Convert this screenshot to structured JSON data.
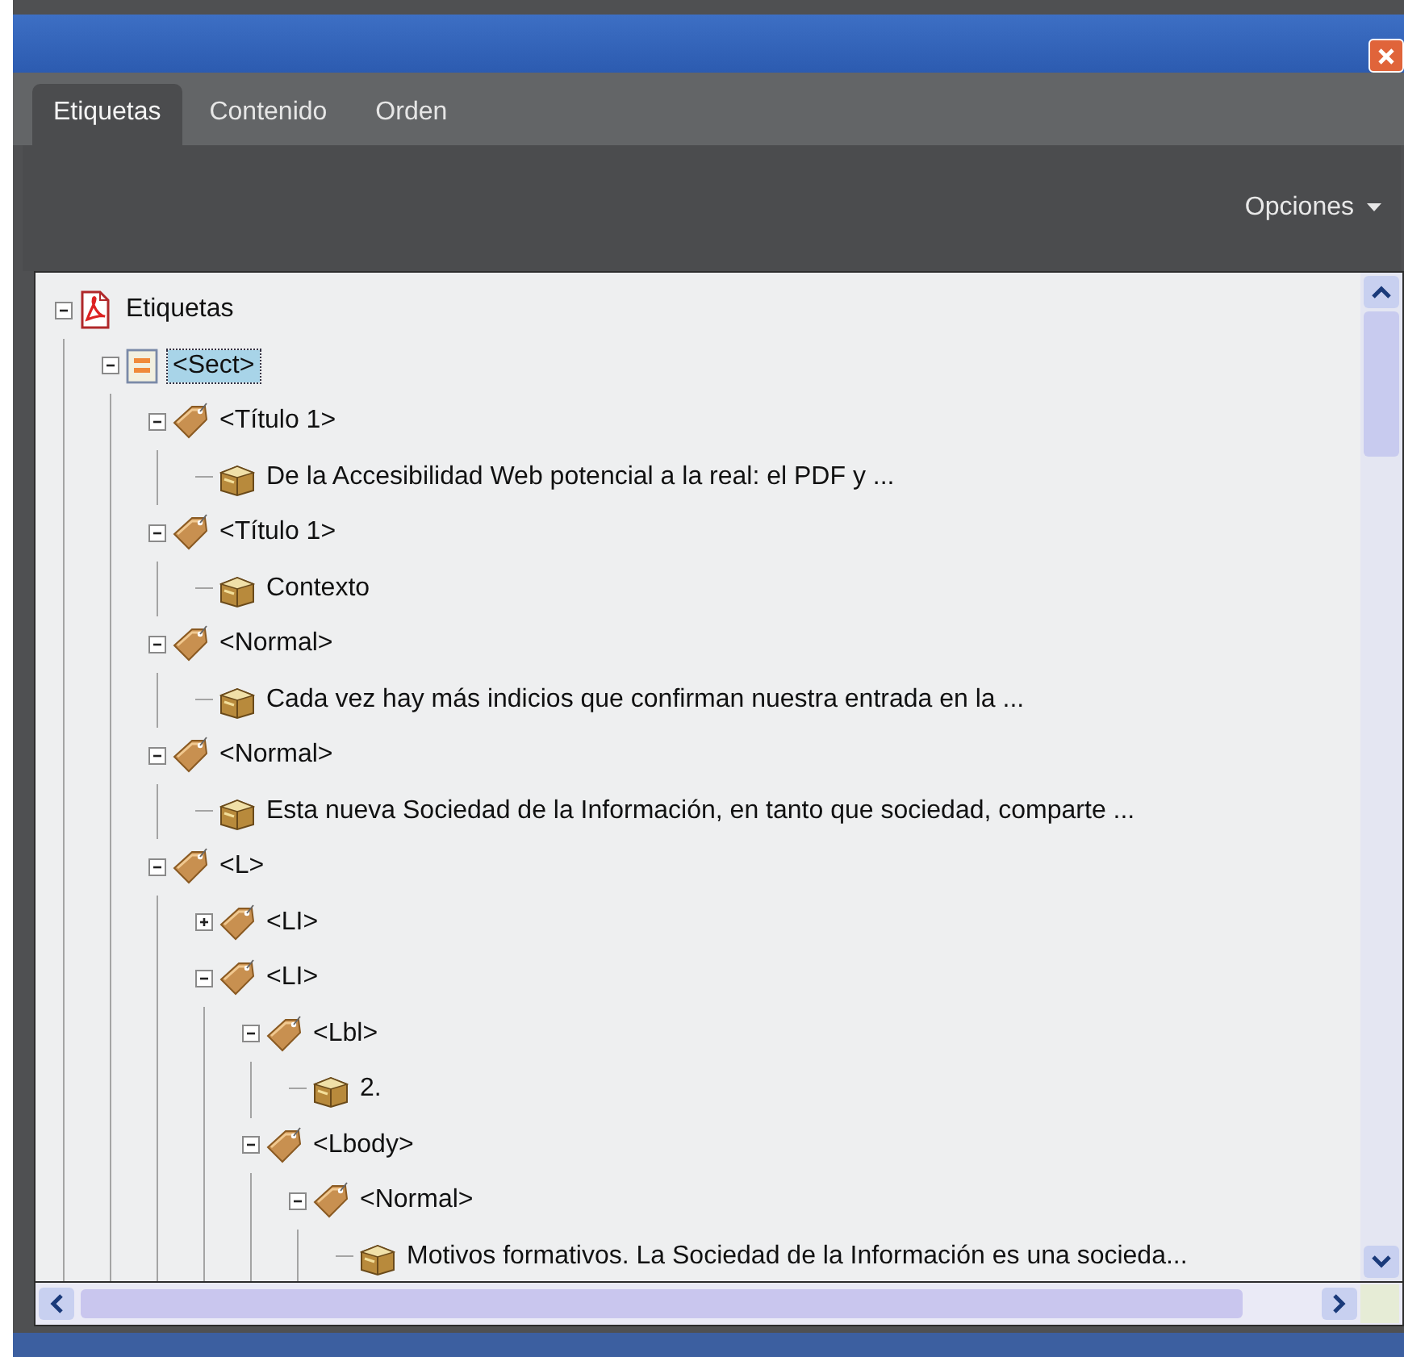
{
  "window": {
    "close_button": true
  },
  "tabs": [
    {
      "label": "Etiquetas",
      "selected": true
    },
    {
      "label": "Contenido",
      "selected": false
    },
    {
      "label": "Orden",
      "selected": false
    }
  ],
  "toolbar": {
    "menu": "Opciones"
  },
  "tree": [
    {
      "label": "Etiquetas",
      "kind": "pdf",
      "expanded": true,
      "selected": false,
      "children": [
        {
          "label": "<Sect>",
          "kind": "sect",
          "expanded": true,
          "selected": true,
          "children": [
            {
              "label": "<Título 1>",
              "kind": "tag",
              "expanded": true,
              "selected": false,
              "children": [
                {
                  "label": "De la Accesibilidad Web potencial a la real: el PDF y ...",
                  "kind": "content",
                  "selected": false
                }
              ]
            },
            {
              "label": "<Título 1>",
              "kind": "tag",
              "expanded": true,
              "selected": false,
              "children": [
                {
                  "label": "Contexto",
                  "kind": "content",
                  "selected": false
                }
              ]
            },
            {
              "label": "<Normal>",
              "kind": "tag",
              "expanded": true,
              "selected": false,
              "children": [
                {
                  "label": "Cada vez hay más indicios que confirman nuestra entrada en la ...",
                  "kind": "content",
                  "selected": false
                }
              ]
            },
            {
              "label": "<Normal>",
              "kind": "tag",
              "expanded": true,
              "selected": false,
              "children": [
                {
                  "label": "Esta nueva Sociedad de la Información, en tanto que sociedad, comparte ...",
                  "kind": "content",
                  "selected": false
                }
              ]
            },
            {
              "label": "<L>",
              "kind": "tag",
              "expanded": true,
              "selected": false,
              "children": [
                {
                  "label": "<LI>",
                  "kind": "tag",
                  "expanded": false,
                  "selected": false
                },
                {
                  "label": "<LI>",
                  "kind": "tag",
                  "expanded": true,
                  "selected": false,
                  "children": [
                    {
                      "label": "<Lbl>",
                      "kind": "tag",
                      "expanded": true,
                      "selected": false,
                      "children": [
                        {
                          "label": "2.",
                          "kind": "content",
                          "selected": false
                        }
                      ]
                    },
                    {
                      "label": "<Lbody>",
                      "kind": "tag",
                      "expanded": true,
                      "selected": false,
                      "children": [
                        {
                          "label": "<Normal>",
                          "kind": "tag",
                          "expanded": true,
                          "selected": false,
                          "children": [
                            {
                              "label": "Motivos formativos. La Sociedad de la Información es una socieda...",
                              "kind": "content",
                              "selected": false
                            }
                          ]
                        }
                      ]
                    }
                  ]
                }
              ]
            }
          ]
        }
      ]
    }
  ]
}
